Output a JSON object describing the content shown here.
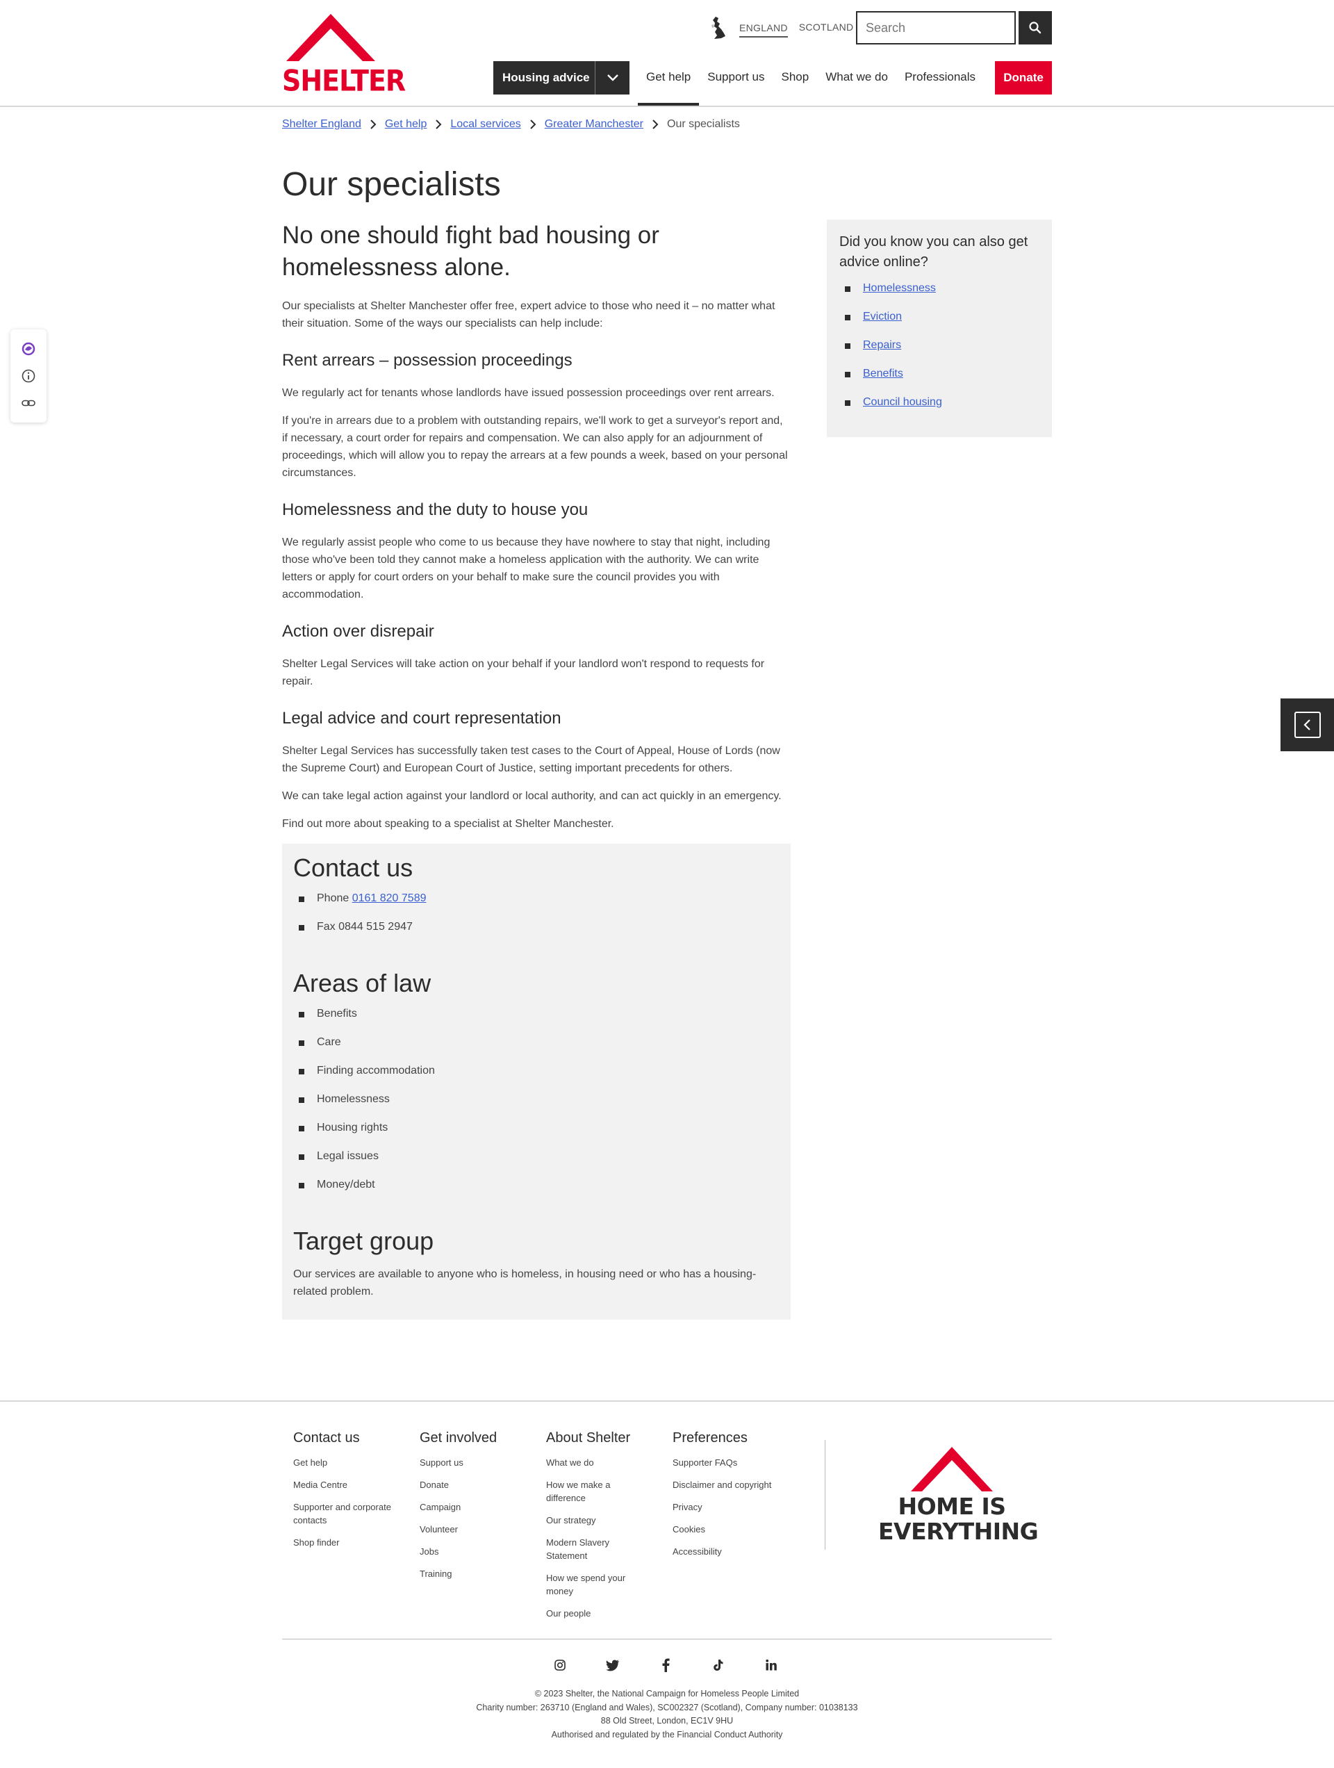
{
  "header": {
    "logo_text": "SHELTER",
    "region": {
      "england": "ENGLAND",
      "scotland": "SCOTLAND"
    },
    "search_placeholder": "Search",
    "housing_dropdown": "Housing advice",
    "nav": [
      "Get help",
      "Support us",
      "Shop",
      "What we do",
      "Professionals"
    ],
    "active_nav": "Get help",
    "donate": "Donate"
  },
  "breadcrumb": {
    "links": [
      "Shelter England",
      "Get help",
      "Local services",
      "Greater Manchester"
    ],
    "current": "Our specialists"
  },
  "page": {
    "title": "Our specialists",
    "lead": "No one should fight bad housing or homelessness alone.",
    "intro": "Our specialists at Shelter Manchester offer free, expert advice to those who need it – no matter what their situation. Some of the ways our specialists can help include:",
    "sections": [
      {
        "heading": "Rent arrears – possession proceedings",
        "paragraphs": [
          "We regularly act for tenants whose landlords have issued possession proceedings over rent arrears.",
          "If you're in arrears due to a problem with outstanding repairs, we'll work to get a surveyor's report and, if necessary, a court order for repairs and compensation. We can also apply for an adjournment of proceedings, which will allow you to repay the arrears at a few pounds a week, based on your personal circumstances."
        ]
      },
      {
        "heading": "Homelessness and the duty to house you",
        "paragraphs": [
          "We regularly assist people who come to us because they have nowhere to stay that night, including those who've been told they cannot make a homeless application with the authority. We can write letters or apply for court orders on your behalf to make sure the council provides you with accommodation."
        ]
      },
      {
        "heading": "Action over disrepair",
        "paragraphs": [
          "Shelter Legal Services will take action on your behalf if your landlord won't respond to requests for repair."
        ]
      },
      {
        "heading": "Legal advice and court representation",
        "paragraphs": [
          "Shelter Legal Services has successfully taken test cases to the Court of Appeal, House of Lords (now the Supreme Court) and European Court of Justice, setting important precedents for others.",
          "We can take legal action against your landlord or local authority, and can act quickly in an emergency.",
          "Find out more about speaking to a specialist at Shelter Manchester."
        ]
      }
    ]
  },
  "infobox": {
    "contact_title": "Contact us",
    "phone_label": "Phone",
    "phone_number": "0161 820 7589",
    "fax": "Fax 0844 515 2947",
    "areas_title": "Areas of law",
    "areas": [
      "Benefits",
      "Care",
      "Finding accommodation",
      "Homelessness",
      "Housing rights",
      "Legal issues",
      "Money/debt"
    ],
    "target_title": "Target group",
    "target_text": "Our services are available to anyone who is homeless, in housing need or who has a housing-related problem."
  },
  "sidebar": {
    "title": "Did you know you can also get advice online?",
    "links": [
      "Homelessness",
      "Eviction",
      "Repairs",
      "Benefits",
      "Council housing"
    ]
  },
  "footer": {
    "columns": [
      {
        "title": "Contact us",
        "links": [
          "Get help",
          "Media Centre",
          "Supporter and corporate contacts",
          "Shop finder"
        ]
      },
      {
        "title": "Get involved",
        "links": [
          "Support us",
          "Donate",
          "Campaign",
          "Volunteer",
          "Jobs",
          "Training"
        ]
      },
      {
        "title": "About Shelter",
        "links": [
          "What we do",
          "How we make a difference",
          "Our strategy",
          "Modern Slavery Statement",
          "How we spend your money",
          "Our people"
        ]
      },
      {
        "title": "Preferences",
        "links": [
          "Supporter FAQs",
          "Disclaimer and copyright",
          "Privacy",
          "Cookies",
          "Accessibility"
        ]
      }
    ],
    "logo_line1": "HOME IS",
    "logo_line2": "EVERYTHING",
    "social_icons": [
      "instagram-icon",
      "twitter-icon",
      "facebook-icon",
      "tiktok-icon",
      "linkedin-icon"
    ],
    "legal": [
      "© 2023 Shelter, the National Campaign for Homeless People Limited",
      "Charity number: 263710 (England and Wales), SC002327 (Scotland), Company number: 01038133",
      "88 Old Street, London, EC1V 9HU",
      "Authorised and regulated by the Financial Conduct Authority"
    ]
  },
  "colors": {
    "brand_red": "#e3002b",
    "dark": "#2c2c2c",
    "link": "#3a5fd0",
    "panel": "#f2f2f2"
  }
}
